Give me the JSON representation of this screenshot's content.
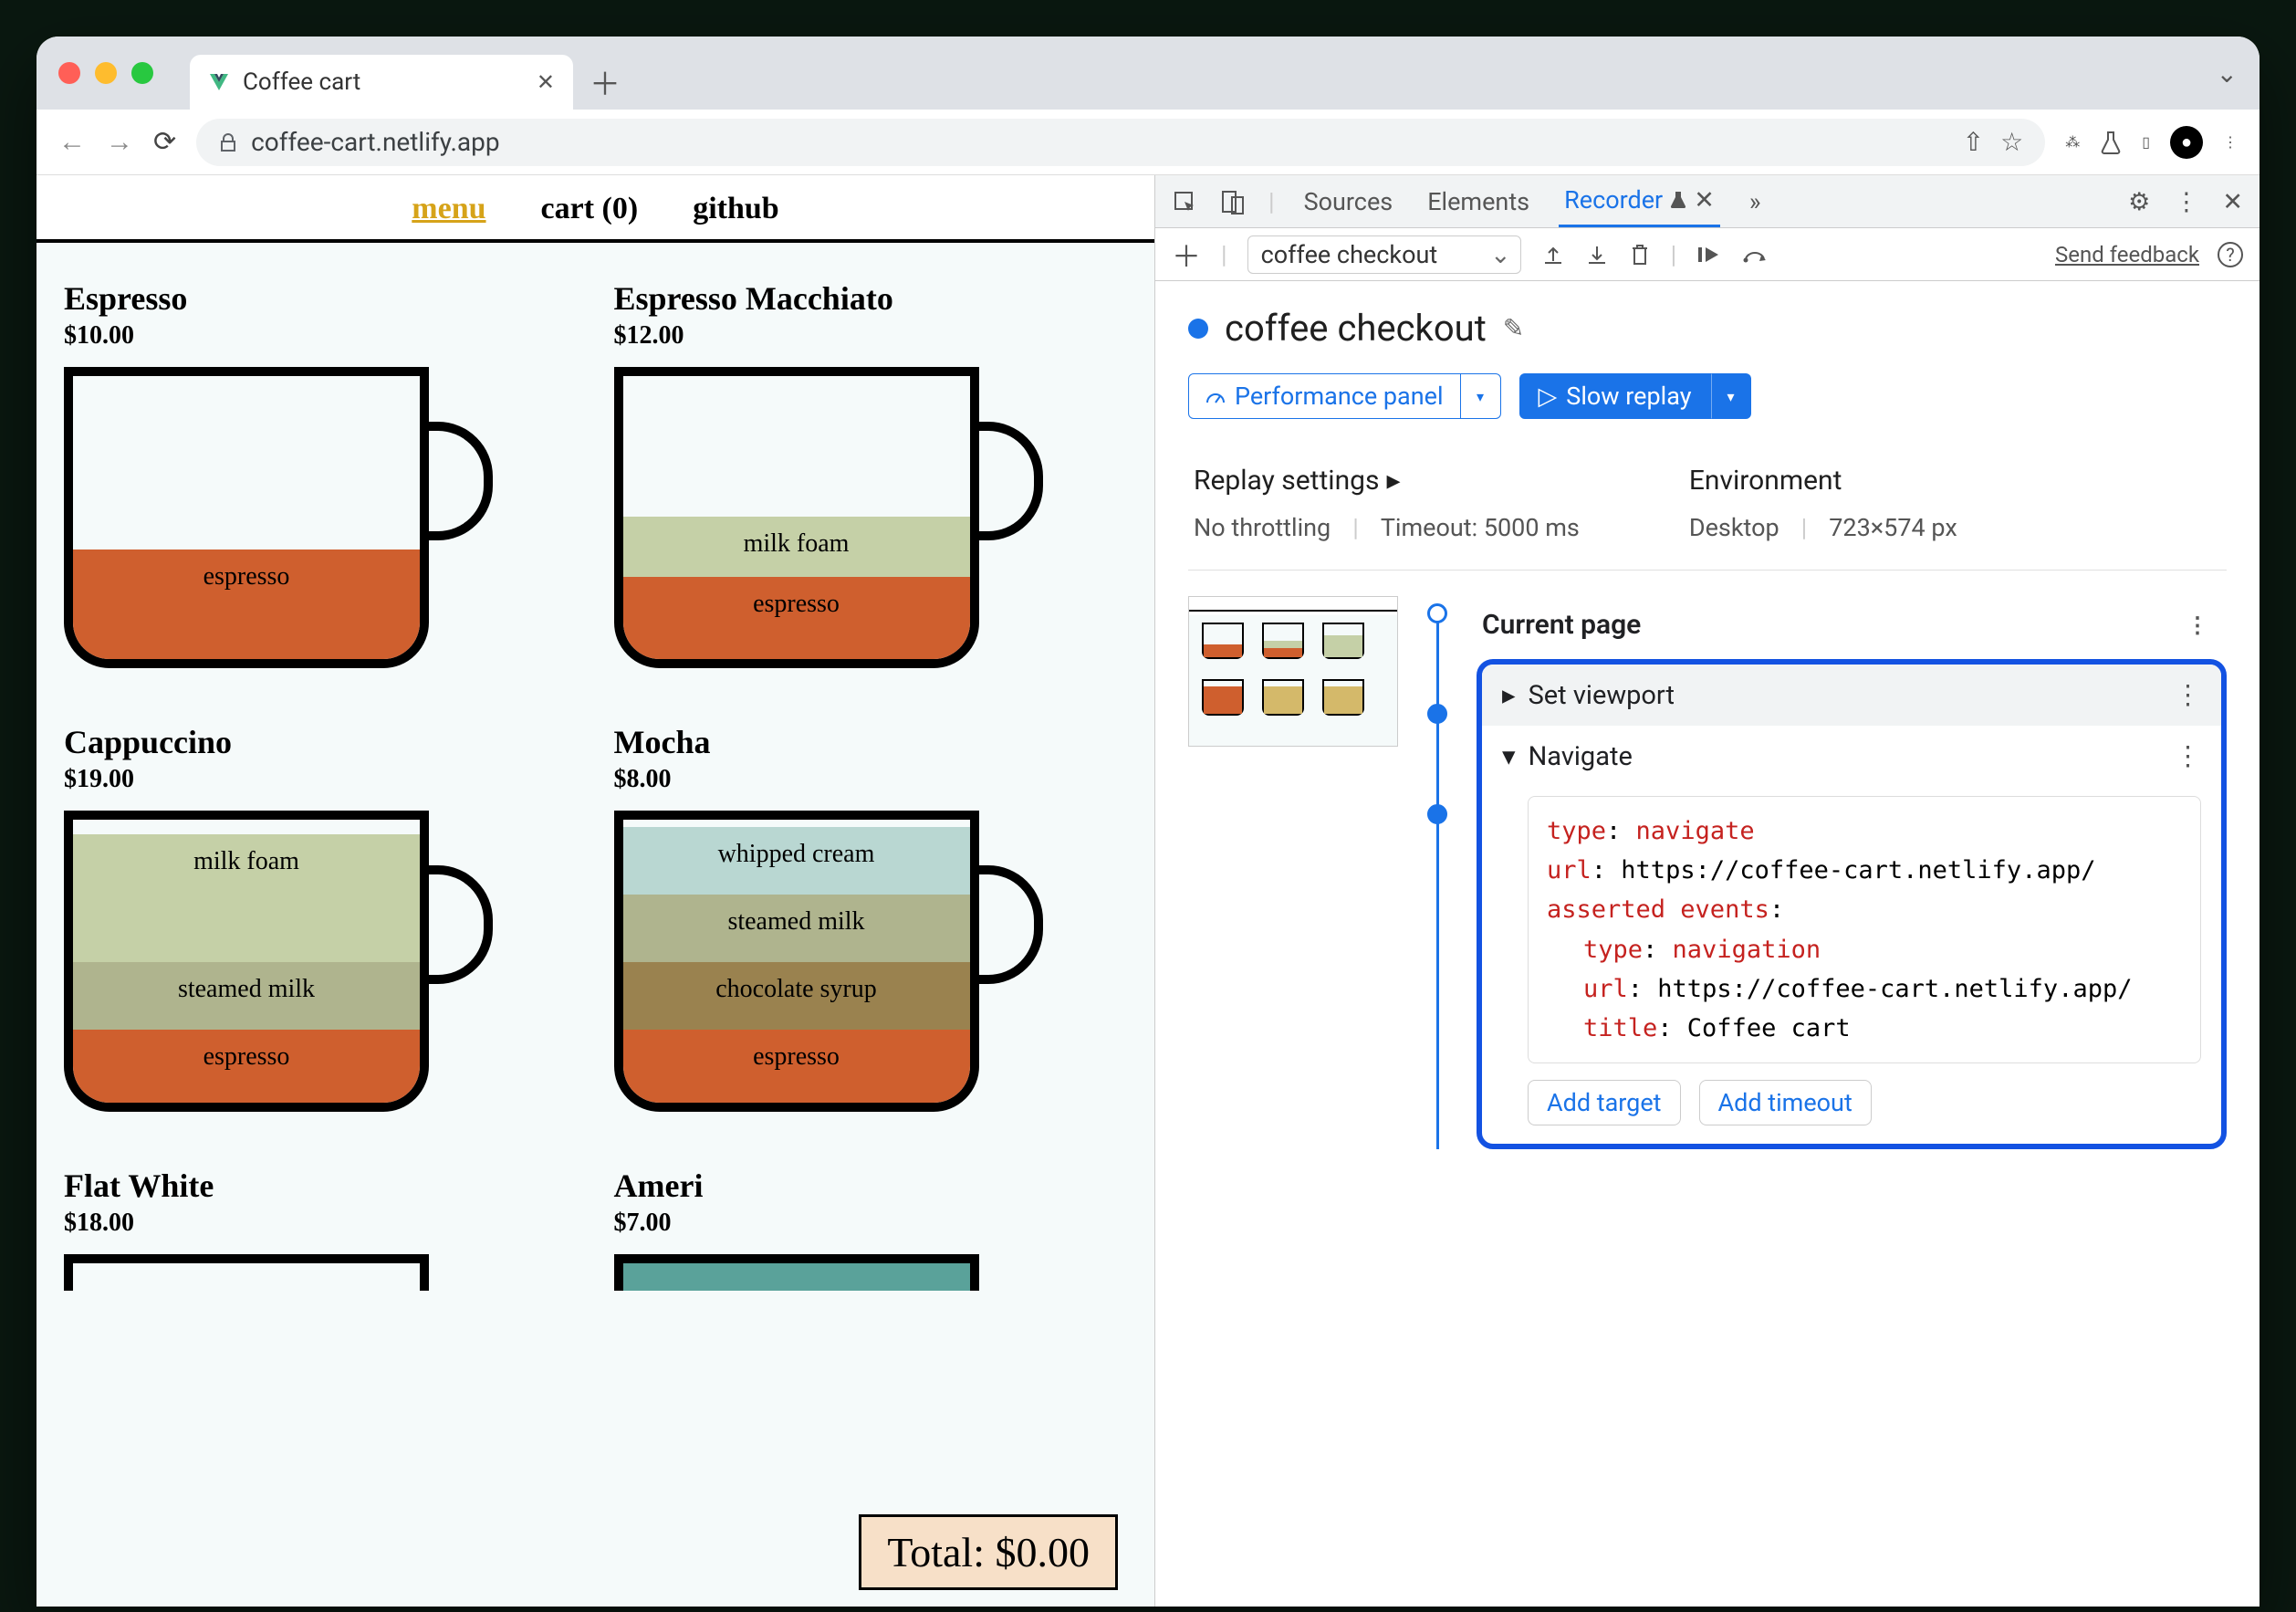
{
  "browser": {
    "tab_title": "Coffee cart",
    "url": "coffee-cart.netlify.app"
  },
  "page_nav": {
    "menu": "menu",
    "cart": "cart (0)",
    "github": "github"
  },
  "products": [
    {
      "name": "Espresso",
      "price": "$10.00",
      "layers": [
        [
          "espresso",
          "l-espresso",
          120
        ]
      ]
    },
    {
      "name": "Espresso Macchiato",
      "price": "$12.00",
      "layers": [
        [
          "milk foam",
          "l-milkfoam",
          60
        ],
        [
          "espresso",
          "l-espresso",
          80
        ]
      ]
    },
    {
      "name": "Cappuccino",
      "price": "$19.00",
      "layers": [
        [
          "milk foam",
          "l-milkfoam",
          130
        ],
        [
          "steamed milk",
          "l-steamedmilk",
          70
        ],
        [
          "espresso",
          "l-espresso",
          80
        ]
      ]
    },
    {
      "name": "Mocha",
      "price": "$8.00",
      "layers": [
        [
          "whipped cream",
          "l-whipped",
          70
        ],
        [
          "steamed milk",
          "l-steamedmilk",
          70
        ],
        [
          "chocolate syrup",
          "l-chocolate",
          70
        ],
        [
          "espresso",
          "l-espresso",
          80
        ]
      ]
    },
    {
      "name": "Flat White",
      "price": "$18.00",
      "layers": []
    },
    {
      "name": "Ameri",
      "price": "$7.00",
      "layers": []
    }
  ],
  "ingredient_labels": {
    "espresso": "espresso",
    "milk_foam": "milk foam",
    "steamed_milk": "steamed milk",
    "whipped_cream": "whipped cream",
    "chocolate_syrup": "chocolate syrup"
  },
  "total": "Total: $0.00",
  "devtools": {
    "tabs": {
      "sources": "Sources",
      "elements": "Elements",
      "recorder": "Recorder"
    },
    "selected_recording": "coffee checkout",
    "send_feedback": "Send feedback",
    "recording_title": "coffee checkout",
    "perf_btn": "Performance panel",
    "replay_btn": "Slow replay",
    "settings": {
      "replay_h": "Replay settings",
      "no_throttle": "No throttling",
      "timeout": "Timeout: 5000 ms",
      "env_h": "Environment",
      "env_device": "Desktop",
      "env_size": "723×574 px"
    },
    "steps": {
      "current": "Current page",
      "set_viewport": "Set viewport",
      "navigate": "Navigate",
      "detail": {
        "type_k": "type",
        "type_v": "navigate",
        "url_k": "url",
        "url_v": "https://coffee-cart.netlify.app/",
        "asserted_k": "asserted events",
        "nav_type_k": "type",
        "nav_type_v": "navigation",
        "nav_url_k": "url",
        "nav_url_v": "https://coffee-cart.netlify.app/",
        "title_k": "title",
        "title_v": "Coffee cart"
      },
      "add_target": "Add target",
      "add_timeout": "Add timeout"
    }
  }
}
